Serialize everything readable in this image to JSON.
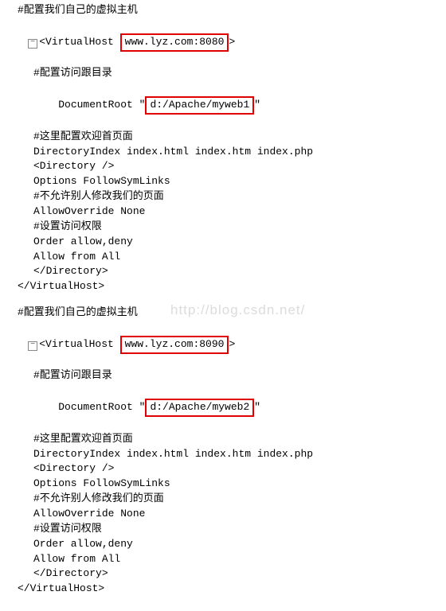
{
  "block1": {
    "comment_title": "#配置我们自己的虚拟主机",
    "vhost_open_a": "<VirtualHost ",
    "vhost_open_b": "www.lyz.com:8080",
    "vhost_open_c": ">",
    "comment_root": "#配置访问跟目录",
    "docroot_a": "DocumentRoot \"",
    "docroot_b": "d:/Apache/myweb1",
    "docroot_c": "\"",
    "comment_welcome": "#这里配置欢迎首页面",
    "directory_index": "DirectoryIndex index.html index.htm index.php",
    "directory_open": "<Directory />",
    "options": "Options FollowSymLinks",
    "comment_noedit": "#不允许别人修改我们的页面",
    "allowoverride": "AllowOverride None",
    "comment_perm": "#设置访问权限",
    "order": "Order allow,deny",
    "allow": "Allow from All",
    "directory_close": "</Directory>",
    "vhost_close": "</VirtualHost>"
  },
  "block2": {
    "comment_title": "#配置我们自己的虚拟主机",
    "vhost_open_a": "<VirtualHost ",
    "vhost_open_b": "www.lyz.com:8090",
    "vhost_open_c": ">",
    "comment_root": "#配置访问跟目录",
    "docroot_a": "DocumentRoot \"",
    "docroot_b": "d:/Apache/myweb2",
    "docroot_c": "\"",
    "comment_welcome": "#这里配置欢迎首页面",
    "directory_index": "DirectoryIndex index.html index.htm index.php",
    "directory_open": "<Directory />",
    "options": "Options FollowSymLinks",
    "comment_noedit": "#不允许别人修改我们的页面",
    "allowoverride": "AllowOverride None",
    "comment_perm": "#设置访问权限",
    "order": "Order allow,deny",
    "allow": "Allow from All",
    "directory_close": "</Directory>",
    "vhost_close": "</VirtualHost>"
  },
  "watermark": "http://blog.csdn.net/",
  "fold_symbol": "−"
}
